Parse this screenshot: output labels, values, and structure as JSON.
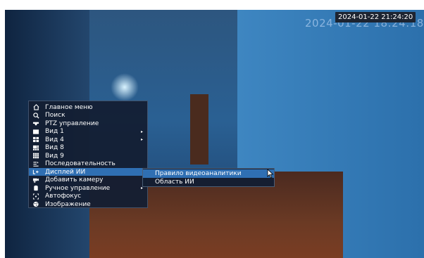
{
  "overlay": {
    "timestamp": "2024-01-22 21:24:20",
    "timestamp_ghost": "2024-01-22 18:24:18"
  },
  "context_menu": {
    "items": [
      {
        "label": "Главное меню",
        "icon": "home-icon"
      },
      {
        "label": "Поиск",
        "icon": "search-icon"
      },
      {
        "label": "PTZ управление",
        "icon": "ptz-icon"
      },
      {
        "label": "Вид 1",
        "icon": "view1-icon",
        "has_submenu": true
      },
      {
        "label": "Вид 4",
        "icon": "view4-icon",
        "has_submenu": true
      },
      {
        "label": "Вид 8",
        "icon": "view8-icon"
      },
      {
        "label": "Вид 9",
        "icon": "view9-icon"
      },
      {
        "label": "Последовательность",
        "icon": "sequence-icon"
      },
      {
        "label": "Дисплей ИИ",
        "icon": "ai-display-icon",
        "selected": true
      },
      {
        "label": "Добавить камеру",
        "icon": "add-camera-icon"
      },
      {
        "label": "Ручное управление",
        "icon": "manual-control-icon",
        "has_submenu": true
      },
      {
        "label": "Автофокус",
        "icon": "autofocus-icon"
      },
      {
        "label": "Изображение",
        "icon": "image-icon"
      }
    ]
  },
  "submenu": {
    "items": [
      {
        "label": "Правило видеоаналитики",
        "selected": true
      },
      {
        "label": "Область ИИ"
      }
    ]
  },
  "colors": {
    "menu_bg": "#131e32",
    "highlight": "#2f6fb3",
    "text": "#ffffff"
  }
}
